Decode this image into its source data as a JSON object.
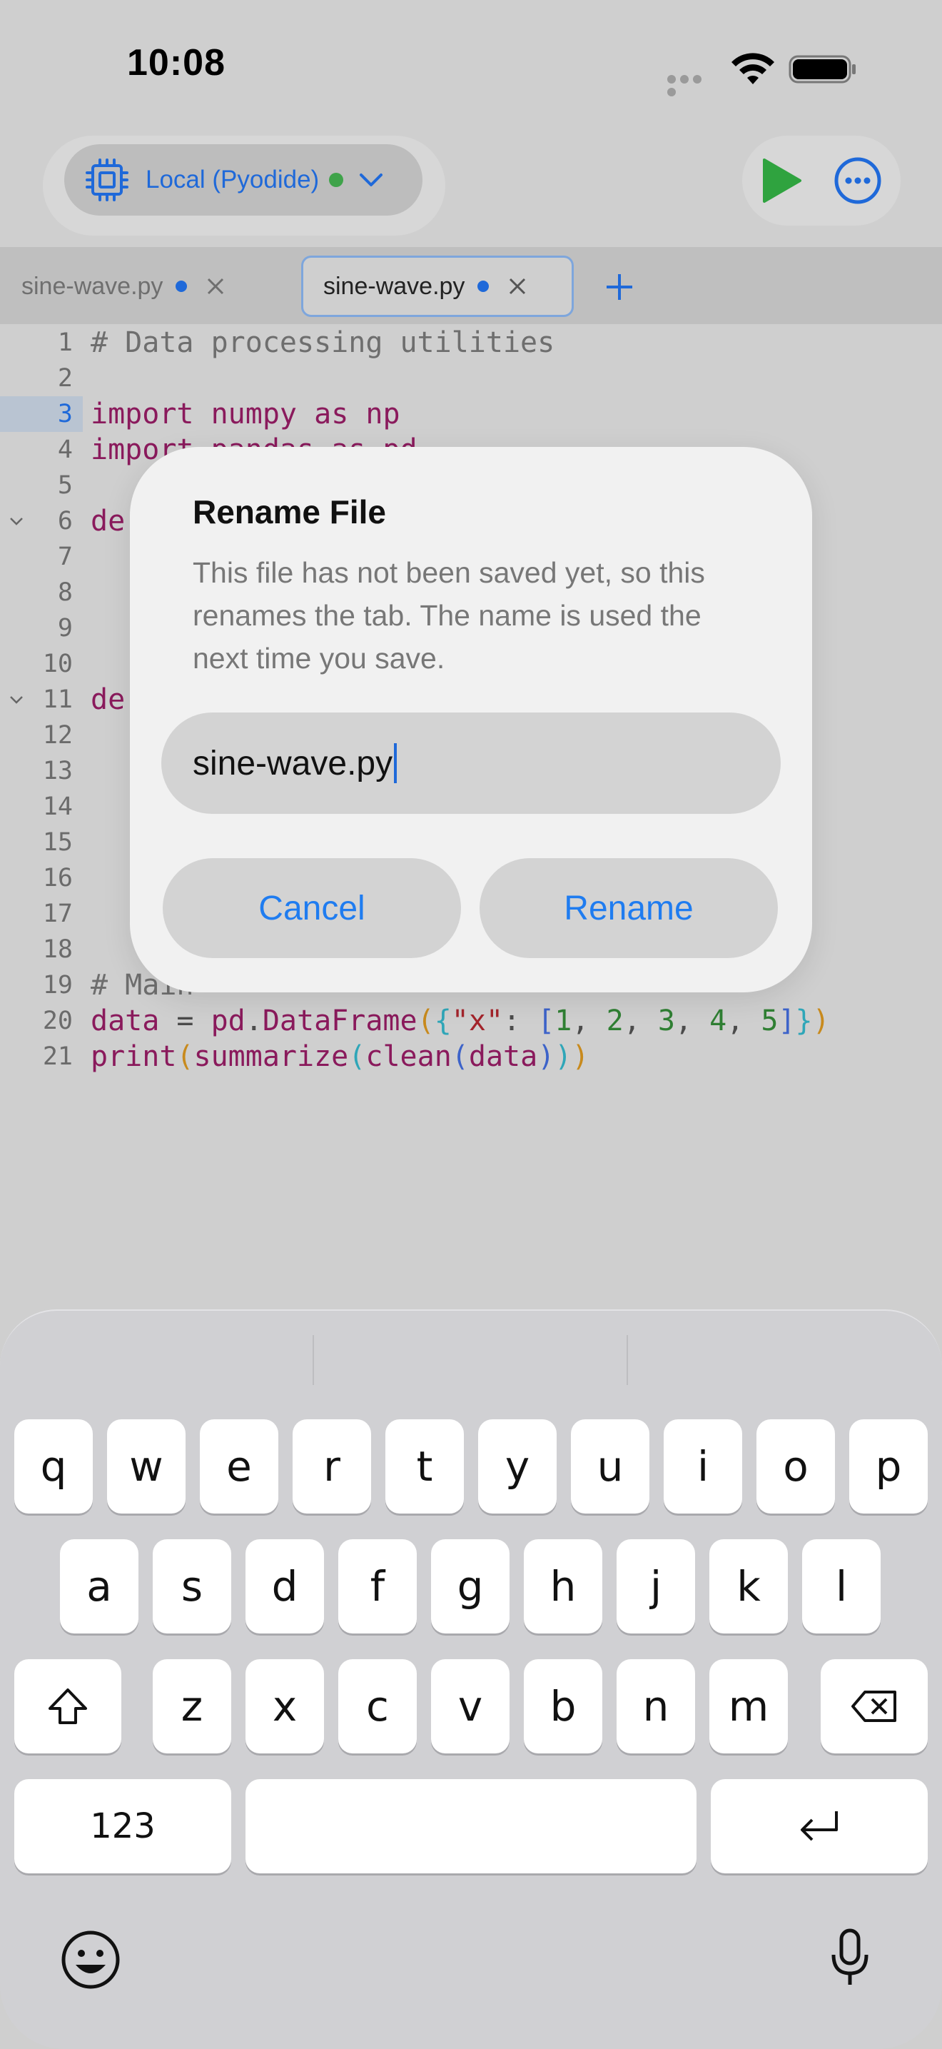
{
  "status_bar": {
    "time": "10:08"
  },
  "toolbar": {
    "runtime_label": "Local (Pyodide)"
  },
  "tabs": [
    {
      "label": "sine-wave.py",
      "active": false
    },
    {
      "label": "sine-wave.py",
      "active": true
    }
  ],
  "editor": {
    "current_line": 3,
    "lines": [
      {
        "n": "1",
        "text": "# Data processing utilities"
      },
      {
        "n": "2",
        "text": ""
      },
      {
        "n": "3",
        "text": "import numpy as np"
      },
      {
        "n": "4",
        "text": "import pandas as pd"
      },
      {
        "n": "5",
        "text": ""
      },
      {
        "n": "6",
        "text": "de"
      },
      {
        "n": "7",
        "text": ""
      },
      {
        "n": "8",
        "text": ""
      },
      {
        "n": "9",
        "text": ""
      },
      {
        "n": "10",
        "text": ""
      },
      {
        "n": "11",
        "text": "de"
      },
      {
        "n": "12",
        "text": ""
      },
      {
        "n": "13",
        "text": ""
      },
      {
        "n": "14",
        "text": ""
      },
      {
        "n": "15",
        "text": ""
      },
      {
        "n": "16",
        "text": ""
      },
      {
        "n": "17",
        "text": ""
      },
      {
        "n": "18",
        "text": ""
      },
      {
        "n": "19",
        "text": "# Main"
      },
      {
        "n": "20",
        "text": "data = pd.DataFrame({\"x\": [1, 2, 3, 4, 5]})"
      },
      {
        "n": "21",
        "text": "print(summarize(clean(data)))"
      }
    ]
  },
  "dialog": {
    "title": "Rename File",
    "message": "This file has not been saved yet, so this renames the tab. The name is used the next time you save.",
    "field_value": "sine-wave.py",
    "cancel_label": "Cancel",
    "rename_label": "Rename"
  },
  "keyboard": {
    "row1": [
      "q",
      "w",
      "e",
      "r",
      "t",
      "y",
      "u",
      "i",
      "o",
      "p"
    ],
    "row2": [
      "a",
      "s",
      "d",
      "f",
      "g",
      "h",
      "j",
      "k",
      "l"
    ],
    "row3": [
      "z",
      "x",
      "c",
      "v",
      "b",
      "n",
      "m"
    ],
    "numbers_label": "123"
  }
}
